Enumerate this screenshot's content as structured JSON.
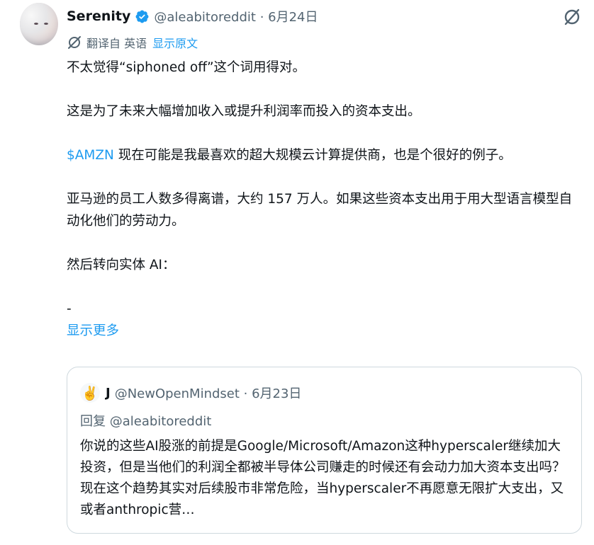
{
  "post": {
    "author_name": "Serenity",
    "meta": "@aleabitoreddit · 6月24日",
    "translate_label": "翻译自 英语",
    "translate_link": "显示原文",
    "lines": {
      "l1": "不太觉得“siphoned off”这个词用得对。",
      "l2": "这是为了未来大幅增加收入或提升利润率而投入的资本支出。",
      "cashtag": "$AMZN",
      "l3_rest": " 现在可能是我最喜欢的超大规模云计算提供商，也是个很好的例子。",
      "l4": "亚马逊的员工人数多得离谱，大约 157 万人。如果这些资本支出用于用大型语言模型自动化他们的劳动力。",
      "l5": "然后转向实体 AI：",
      "l6": "-"
    },
    "show_more": "显示更多"
  },
  "quote": {
    "avatar_emoji": "✌️",
    "author_name": "J",
    "meta": "@NewOpenMindset · 6月23日",
    "reply_to": "回复 @aleabitoreddit",
    "text": "你说的这些AI股涨的前提是Google/Microsoft/Amazon这种hyperscaler继续加大投资，但是当他们的利润全都被半导体公司赚走的时候还有会动力加大资本支出吗？现在这个趋势其实对后续股市非常危险，当hyperscaler不再愿意无限扩大支出，又或者anthropic营…"
  },
  "colors": {
    "accent": "#1d9bf0",
    "secondary_text": "#536471",
    "primary_text": "#0f1419",
    "border": "#cfd9de"
  },
  "icons": {
    "verified": "verified-badge-icon",
    "grok": "grok-icon",
    "translate": "translate-icon"
  }
}
